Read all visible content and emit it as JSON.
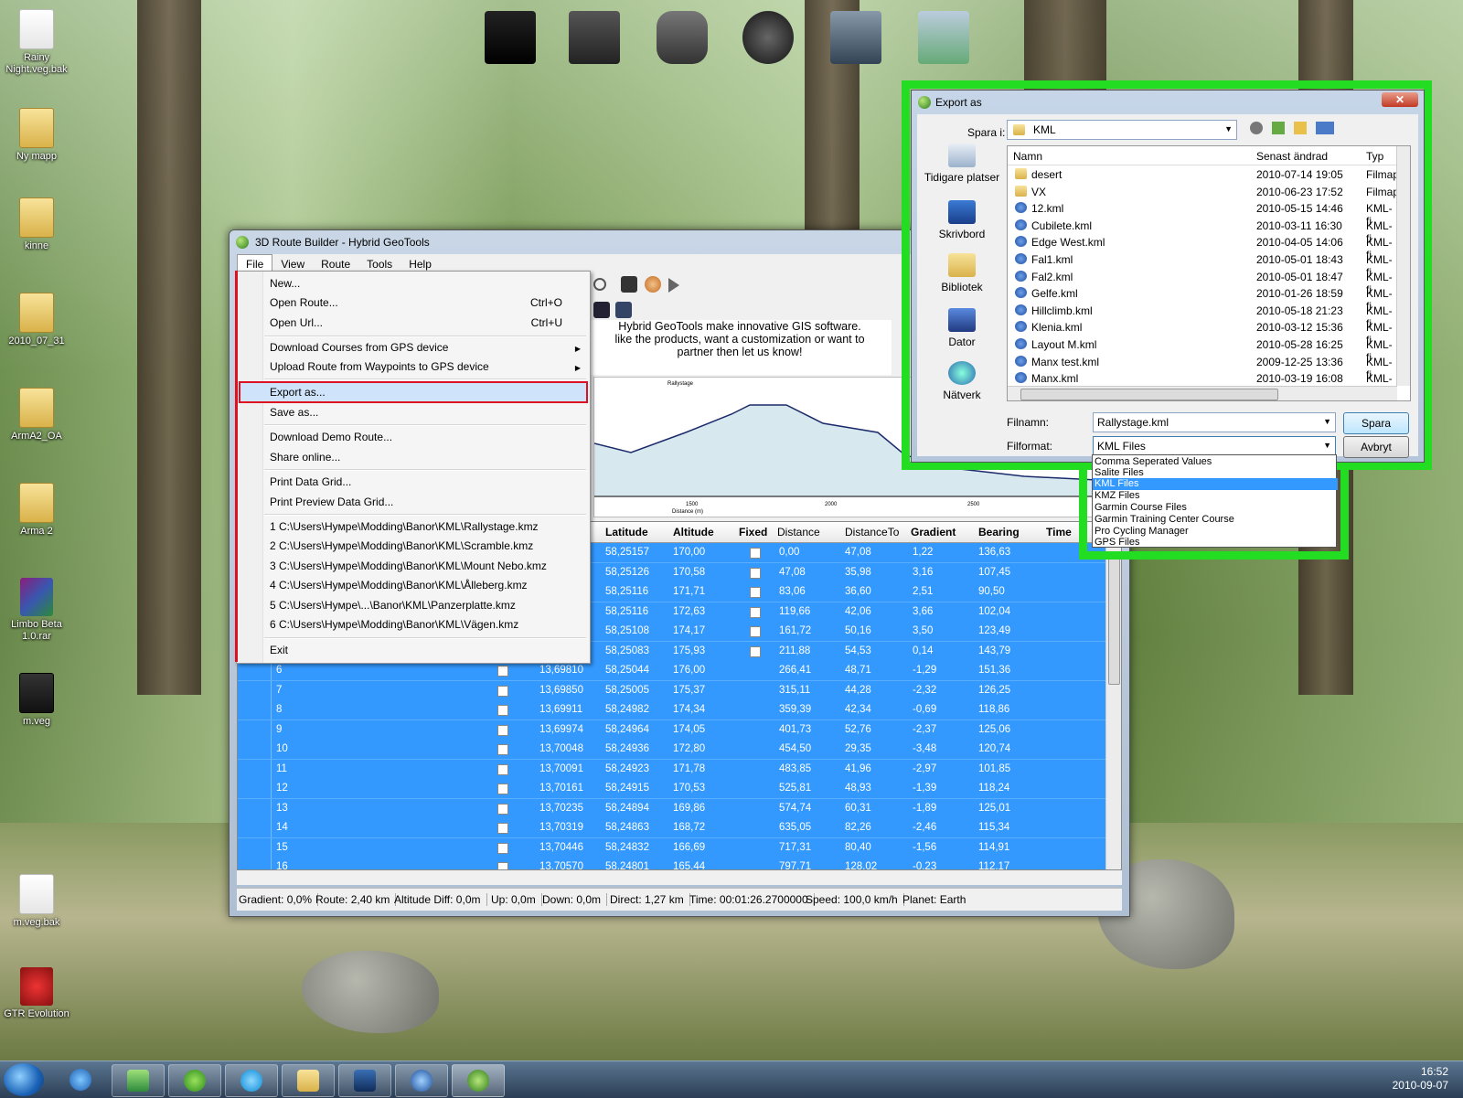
{
  "desktop": {
    "icons": [
      {
        "label": "Rainy Night.veg.bak"
      },
      {
        "label": "Ny mapp"
      },
      {
        "label": "kinne"
      },
      {
        "label": "2010_07_31"
      },
      {
        "label": "ArmA2_OA"
      },
      {
        "label": "Arma 2"
      },
      {
        "label": "Limbo Beta 1.0.rar"
      },
      {
        "label": "m.veg"
      },
      {
        "label": "m.veg.bak"
      },
      {
        "label": "GTR Evolution"
      }
    ]
  },
  "main_window": {
    "title": "3D Route Builder - Hybrid GeoTools",
    "menu": [
      "File",
      "View",
      "Route",
      "Tools",
      "Help"
    ],
    "banner": "Hybrid GeoTools make innovative GIS software. like the products, want a customization or want to partner then let us know!",
    "banner_lines": [
      "Hybrid GeoTools make innovative GIS software.",
      "like the products, want a customization or want to",
      "partner then let us know!"
    ],
    "chart_title": "Rallystage",
    "chart_xlabel": "Distance (m)",
    "chart_ticks": [
      "1500",
      "2000",
      "2500"
    ]
  },
  "file_menu": {
    "items": [
      {
        "label": "New...",
        "shortcut": ""
      },
      {
        "label": "Open Route...",
        "shortcut": "Ctrl+O"
      },
      {
        "label": "Open Url...",
        "shortcut": "Ctrl+U"
      },
      {
        "label": "Download Courses from GPS device",
        "shortcut": ""
      },
      {
        "label": "Upload Route from Waypoints to GPS device",
        "shortcut": ""
      },
      {
        "label": "Export as...",
        "shortcut": ""
      },
      {
        "label": "Save as...",
        "shortcut": ""
      },
      {
        "label": "Download Demo Route...",
        "shortcut": ""
      },
      {
        "label": "Share online...",
        "shortcut": ""
      },
      {
        "label": "Print Data Grid...",
        "shortcut": ""
      },
      {
        "label": "Print Preview Data Grid...",
        "shortcut": ""
      },
      {
        "label": "1  C:\\Users\\Hумpe\\Modding\\Banor\\KML\\Rallystage.kmz",
        "shortcut": ""
      },
      {
        "label": "2  C:\\Users\\Hумpe\\Modding\\Banor\\KML\\Scramble.kmz",
        "shortcut": ""
      },
      {
        "label": "3  C:\\Users\\Hумpe\\Modding\\Banor\\KML\\Mount Nebo.kmz",
        "shortcut": ""
      },
      {
        "label": "4  C:\\Users\\Hумpe\\Modding\\Banor\\KML\\Ålleberg.kmz",
        "shortcut": ""
      },
      {
        "label": "5  C:\\Users\\Hумpe\\...\\Banor\\KML\\Panzerplatte.kmz",
        "shortcut": ""
      },
      {
        "label": "6  C:\\Users\\Hумpe\\Modding\\Banor\\KML\\Vägen.kmz",
        "shortcut": ""
      },
      {
        "label": "Exit",
        "shortcut": ""
      }
    ]
  },
  "grid": {
    "headers": [
      "Latitude",
      "Altitude",
      "Fixed",
      "Distance",
      "DistanceTo",
      "Gradient",
      "Bearing",
      "Time"
    ],
    "rows": [
      {
        "n": "",
        "lon": "",
        "lat": "58,25157",
        "alt": "170,00",
        "dist": "0,00",
        "dto": "47,08",
        "grad": "1,22",
        "bear": "136,63"
      },
      {
        "n": "",
        "lon": "",
        "lat": "58,25126",
        "alt": "170,58",
        "dist": "47,08",
        "dto": "35,98",
        "grad": "3,16",
        "bear": "107,45"
      },
      {
        "n": "",
        "lon": "",
        "lat": "58,25116",
        "alt": "171,71",
        "dist": "83,06",
        "dto": "36,60",
        "grad": "2,51",
        "bear": "90,50"
      },
      {
        "n": "",
        "lon": "",
        "lat": "58,25116",
        "alt": "172,63",
        "dist": "119,66",
        "dto": "42,06",
        "grad": "3,66",
        "bear": "102,04"
      },
      {
        "n": "",
        "lon": "",
        "lat": "58,25108",
        "alt": "174,17",
        "dist": "161,72",
        "dto": "50,16",
        "grad": "3,50",
        "bear": "123,49"
      },
      {
        "n": "",
        "lon": "",
        "lat": "58,25083",
        "alt": "175,93",
        "dist": "211,88",
        "dto": "54,53",
        "grad": "0,14",
        "bear": "143,79"
      },
      {
        "n": "6",
        "lon": "13,69810",
        "lat": "58,25044",
        "alt": "176,00",
        "dist": "266,41",
        "dto": "48,71",
        "grad": "-1,29",
        "bear": "151,36"
      },
      {
        "n": "7",
        "lon": "13,69850",
        "lat": "58,25005",
        "alt": "175,37",
        "dist": "315,11",
        "dto": "44,28",
        "grad": "-2,32",
        "bear": "126,25"
      },
      {
        "n": "8",
        "lon": "13,69911",
        "lat": "58,24982",
        "alt": "174,34",
        "dist": "359,39",
        "dto": "42,34",
        "grad": "-0,69",
        "bear": "118,86"
      },
      {
        "n": "9",
        "lon": "13,69974",
        "lat": "58,24964",
        "alt": "174,05",
        "dist": "401,73",
        "dto": "52,76",
        "grad": "-2,37",
        "bear": "125,06"
      },
      {
        "n": "10",
        "lon": "13,70048",
        "lat": "58,24936",
        "alt": "172,80",
        "dist": "454,50",
        "dto": "29,35",
        "grad": "-3,48",
        "bear": "120,74"
      },
      {
        "n": "11",
        "lon": "13,70091",
        "lat": "58,24923",
        "alt": "171,78",
        "dist": "483,85",
        "dto": "41,96",
        "grad": "-2,97",
        "bear": "101,85"
      },
      {
        "n": "12",
        "lon": "13,70161",
        "lat": "58,24915",
        "alt": "170,53",
        "dist": "525,81",
        "dto": "48,93",
        "grad": "-1,39",
        "bear": "118,24"
      },
      {
        "n": "13",
        "lon": "13,70235",
        "lat": "58,24894",
        "alt": "169,86",
        "dist": "574,74",
        "dto": "60,31",
        "grad": "-1,89",
        "bear": "125,01"
      },
      {
        "n": "14",
        "lon": "13,70319",
        "lat": "58,24863",
        "alt": "168,72",
        "dist": "635,05",
        "dto": "82,26",
        "grad": "-2,46",
        "bear": "115,34"
      },
      {
        "n": "15",
        "lon": "13,70446",
        "lat": "58,24832",
        "alt": "166,69",
        "dist": "717,31",
        "dto": "80,40",
        "grad": "-1,56",
        "bear": "114,91"
      },
      {
        "n": "16",
        "lon": "13,70570",
        "lat": "58,24801",
        "alt": "165,44",
        "dist": "797,71",
        "dto": "128,02",
        "grad": "-0,23",
        "bear": "112,17"
      }
    ]
  },
  "statusbar": [
    "Gradient: 0,0%",
    "Route: 2,40 km",
    "Altitude Diff: 0,0m",
    "Up: 0,0m",
    "Down: 0,0m",
    "Direct: 1,27 km",
    "Time: 00:01:26.2700000",
    "Speed: 100,0 km/h",
    "Planet: Earth"
  ],
  "export_dialog": {
    "title": "Export as",
    "save_in_label": "Spara i:",
    "save_in_value": "KML",
    "places": [
      "Tidigare platser",
      "Skrivbord",
      "Bibliotek",
      "Dator",
      "Nätverk"
    ],
    "columns": [
      "Namn",
      "Senast ändrad",
      "Typ"
    ],
    "files": [
      {
        "name": "desert",
        "date": "2010-07-14 19:05",
        "type": "Filmap",
        "kind": "folder"
      },
      {
        "name": "VX",
        "date": "2010-06-23 17:52",
        "type": "Filmap",
        "kind": "folder"
      },
      {
        "name": "12.kml",
        "date": "2010-05-15 14:46",
        "type": "KML-fi",
        "kind": "kml"
      },
      {
        "name": "Cubilete.kml",
        "date": "2010-03-11 16:30",
        "type": "KML-fi",
        "kind": "kml"
      },
      {
        "name": "Edge West.kml",
        "date": "2010-04-05 14:06",
        "type": "KML-fi",
        "kind": "kml"
      },
      {
        "name": "Fal1.kml",
        "date": "2010-05-01 18:43",
        "type": "KML-fi",
        "kind": "kml"
      },
      {
        "name": "Fal2.kml",
        "date": "2010-05-01 18:47",
        "type": "KML-fi",
        "kind": "kml"
      },
      {
        "name": "Gelfe.kml",
        "date": "2010-01-26 18:59",
        "type": "KML-fi",
        "kind": "kml"
      },
      {
        "name": "Hillclimb.kml",
        "date": "2010-05-18 21:23",
        "type": "KML-fi",
        "kind": "kml"
      },
      {
        "name": "Klenia.kml",
        "date": "2010-03-12 15:36",
        "type": "KML-fi",
        "kind": "kml"
      },
      {
        "name": "Layout M.kml",
        "date": "2010-05-28 16:25",
        "type": "KML-fi",
        "kind": "kml"
      },
      {
        "name": "Manx test.kml",
        "date": "2009-12-25 13:36",
        "type": "KML-fi",
        "kind": "kml"
      },
      {
        "name": "Manx.kml",
        "date": "2010-03-19 16:08",
        "type": "KML-fi",
        "kind": "kml"
      }
    ],
    "filename_label": "Filnamn:",
    "filename_value": "Rallystage.kml",
    "format_label": "Filformat:",
    "format_value": "KML Files",
    "save_button": "Spara",
    "cancel_button": "Avbryt",
    "format_options": [
      "Comma Seperated Values",
      "Salite Files",
      "KML Files",
      "KMZ Files",
      "Garmin Course Files",
      "Garmin Training Center Course",
      "Pro Cycling Manager",
      "GPS Files"
    ],
    "selected_format_index": 2
  },
  "taskbar": {
    "time": "16:52",
    "date": "2010-09-07"
  }
}
